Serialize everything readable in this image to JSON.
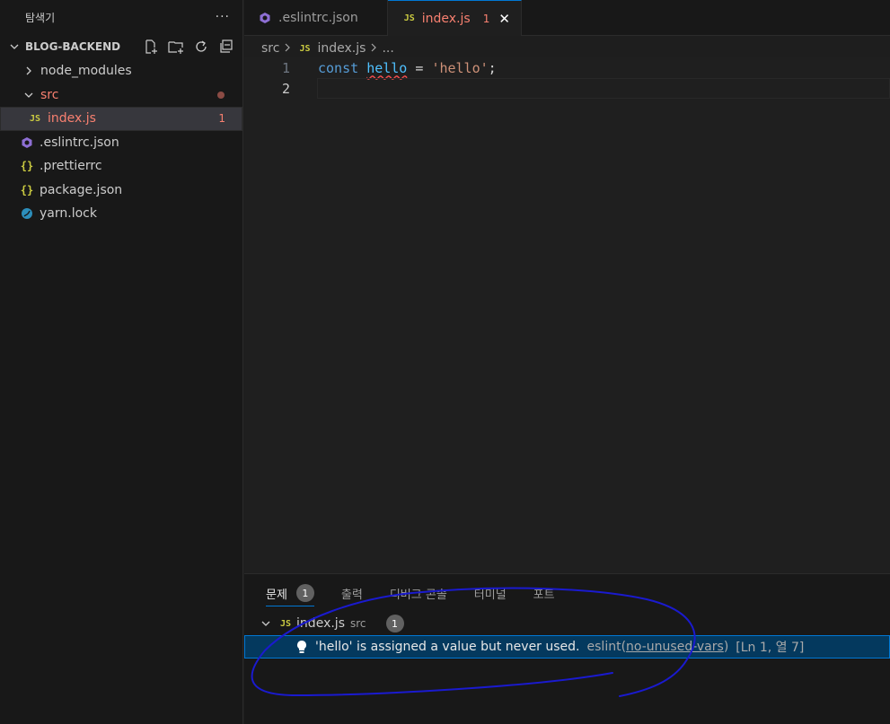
{
  "sidebar": {
    "header_title": "탐색기",
    "more_label": "···",
    "section_title": "BLOG-BACKEND",
    "items": [
      {
        "label": "node_modules",
        "kind": "folder",
        "expanded": false
      },
      {
        "label": "src",
        "kind": "folder",
        "expanded": true
      },
      {
        "label": "index.js",
        "kind": "js",
        "badge": "1"
      },
      {
        "label": ".eslintrc.json",
        "kind": "eslint"
      },
      {
        "label": ".prettierrc",
        "kind": "json"
      },
      {
        "label": "package.json",
        "kind": "json"
      },
      {
        "label": "yarn.lock",
        "kind": "yarn"
      }
    ],
    "icon_js": "JS",
    "icon_json": "{}"
  },
  "tabs": [
    {
      "label": ".eslintrc.json",
      "icon": "eslint-icon"
    },
    {
      "label": "index.js",
      "icon": "js-icon",
      "count": "1",
      "close": "✕"
    }
  ],
  "breadcrumb": {
    "folder": "src",
    "file": "index.js",
    "more": "..."
  },
  "editor": {
    "lines": [
      {
        "number": "1",
        "keyword": "const",
        "variable": "hello",
        "operator": " = ",
        "string": "'hello'",
        "end": ";"
      },
      {
        "number": "2"
      }
    ]
  },
  "panel": {
    "tabs": [
      {
        "label": "문제",
        "count": "1"
      },
      {
        "label": "출력"
      },
      {
        "label": "디버그 콘솔"
      },
      {
        "label": "터미널"
      },
      {
        "label": "포트"
      }
    ],
    "problem_file": {
      "name": "index.js",
      "folder": "src",
      "count": "1"
    },
    "problem": {
      "message": "'hello' is assigned a value but never used.",
      "source": "eslint",
      "rule": "no-unused-vars",
      "position": "[Ln 1, 열 7]"
    }
  },
  "colors": {
    "error": "#f88070",
    "accent": "#0078d4",
    "annotation": "#1a1acf"
  }
}
